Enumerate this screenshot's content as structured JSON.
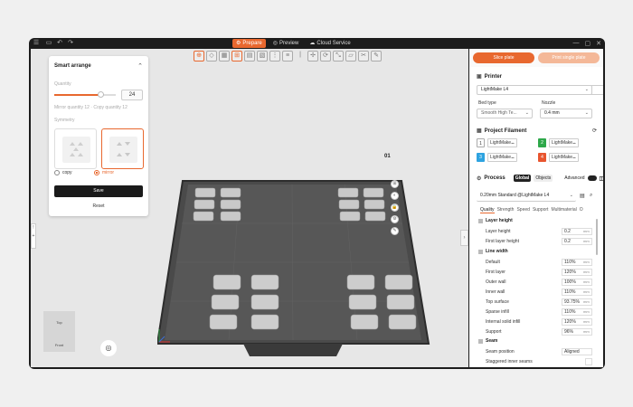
{
  "titlebar": {
    "tabs": [
      {
        "label": "Prepare",
        "active": true
      },
      {
        "label": "Preview",
        "active": false
      },
      {
        "label": "Cloud Service",
        "active": false
      }
    ]
  },
  "smart_arrange": {
    "title": "Smart arrange",
    "quantity_label": "Quantity",
    "quantity_value": "24",
    "quantity_fraction": 0.75,
    "mirror_info": "Mirror quantity 12 · Copy quantity 12",
    "symmetry_label": "Symmetry",
    "options": [
      {
        "label": "copy",
        "selected": false
      },
      {
        "label": "mirror",
        "selected": true
      }
    ],
    "save_label": "Save",
    "reset_label": "Reset"
  },
  "viewport": {
    "plate_label": "01",
    "view_cube_top": "Top",
    "view_cube_front": "Front"
  },
  "slice": {
    "slice_plate": "Slice plate",
    "print_single": "Print single plate"
  },
  "printer": {
    "section_title": "Printer",
    "selected": "LightMake L4",
    "bed_type_label": "Bed type",
    "bed_type_value": "Smooth High Te...",
    "nozzle_label": "Nozzle",
    "nozzle_value": "0.4 mm"
  },
  "filament": {
    "section_title": "Project Filament",
    "slots": [
      {
        "num": "1",
        "color": "#ffffff",
        "name": "LightMake..."
      },
      {
        "num": "2",
        "color": "#2ea84a",
        "name": "LightMake..."
      },
      {
        "num": "3",
        "color": "#2ea3e0",
        "name": "LightMake..."
      },
      {
        "num": "4",
        "color": "#e8552f",
        "name": "LightMake..."
      }
    ]
  },
  "process": {
    "section_title": "Process",
    "toggle_global": "Global",
    "toggle_objects": "Objects",
    "advanced": "Advanced",
    "preset": "0.20mm Standard @LightMake L4",
    "tabs": [
      "Quality",
      "Strength",
      "Speed",
      "Support",
      "Multimaterial",
      "O"
    ],
    "layer_height_group": "Layer height",
    "layer_height_rows": [
      {
        "label": "Layer height",
        "value": "0.2",
        "unit": "mm"
      },
      {
        "label": "First layer height",
        "value": "0.2",
        "unit": "mm"
      }
    ],
    "line_width_group": "Line width",
    "line_width_rows": [
      {
        "label": "Default",
        "value": "110%",
        "unit": "mm"
      },
      {
        "label": "First layer",
        "value": "120%",
        "unit": "mm"
      },
      {
        "label": "Outer wall",
        "value": "100%",
        "unit": "mm"
      },
      {
        "label": "Inner wall",
        "value": "110%",
        "unit": "mm"
      },
      {
        "label": "Top surface",
        "value": "93.75%",
        "unit": "mm"
      },
      {
        "label": "Sparse infill",
        "value": "110%",
        "unit": "mm"
      },
      {
        "label": "Internal solid infill",
        "value": "120%",
        "unit": "mm"
      },
      {
        "label": "Support",
        "value": "96%",
        "unit": "mm"
      }
    ],
    "seam_group": "Seam",
    "seam_rows": [
      {
        "label": "Seam position",
        "value": "Aligned",
        "unit": ""
      },
      {
        "label": "Staggered inner seams",
        "value": "",
        "unit": ""
      }
    ]
  },
  "colors": {
    "accent": "#e8682f",
    "dark": "#1c1c1c"
  }
}
